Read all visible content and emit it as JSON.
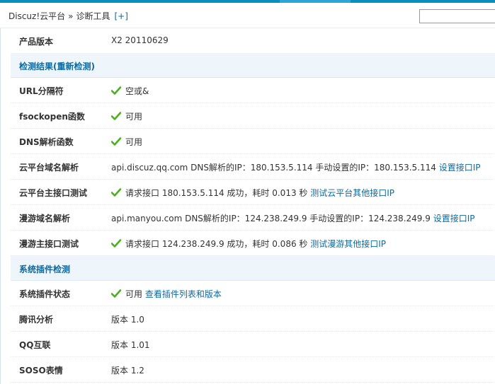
{
  "header": {
    "breadcrumb_root": "Discuz!云平台",
    "breadcrumb_separator": "»",
    "breadcrumb_current": "诊断工具",
    "expand_label": "[+]"
  },
  "colors": {
    "accent": "#0a8ec0",
    "link": "#0a6aa1",
    "check": "#4caf1e",
    "section_bg": "#eef5fb"
  },
  "version": {
    "label": "产品版本",
    "value": "X2 20110629"
  },
  "section_check": {
    "title": "检测结果(重新检测)"
  },
  "url_sep": {
    "label": "URL分隔符",
    "value": "空或&",
    "icon": "check-icon"
  },
  "fsockopen": {
    "label": "fsockopen函数",
    "value": "可用",
    "icon": "check-icon"
  },
  "dns_func": {
    "label": "DNS解析函数",
    "value": "可用",
    "icon": "check-icon"
  },
  "cloud_dns": {
    "label": "云平台域名解析",
    "value": "api.discuz.qq.com DNS解析的IP：180.153.5.114 手动设置的IP：180.153.5.114",
    "link": "设置接口IP"
  },
  "cloud_api": {
    "label": "云平台主接口测试",
    "value": "请求接口 180.153.5.114 成功，耗时 0.013 秒",
    "link": "测试云平台其他接口IP",
    "icon": "check-icon"
  },
  "manyou_dns": {
    "label": "漫游域名解析",
    "value": "api.manyou.com DNS解析的IP：124.238.249.9 手动设置的IP：124.238.249.9",
    "link": "设置接口IP"
  },
  "manyou_api": {
    "label": "漫游主接口测试",
    "value": "请求接口 124.238.249.9 成功，耗时 0.086 秒",
    "link": "测试漫游其他接口IP",
    "icon": "check-icon"
  },
  "section_plugins": {
    "title": "系统插件检测"
  },
  "plugin_status": {
    "label": "系统插件状态",
    "value": "可用",
    "link": "查看插件列表和版本",
    "icon": "check-icon"
  },
  "tencent_analytics": {
    "label": "腾讯分析",
    "value": "版本 1.0"
  },
  "qq_connect": {
    "label": "QQ互联",
    "value": "版本 1.01"
  },
  "soso_smilies": {
    "label": "SOSO表情",
    "value": "版本 1.2"
  }
}
